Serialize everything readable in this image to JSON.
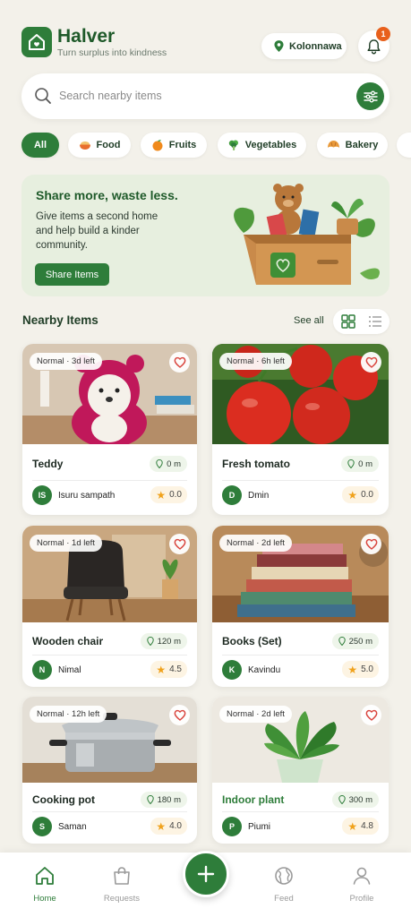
{
  "app": {
    "title": "Halver",
    "tagline": "Turn surplus into kindness",
    "location": "Kolonnawa",
    "notification_count": "1"
  },
  "search": {
    "placeholder": "Search nearby items"
  },
  "categories": [
    {
      "label": "All",
      "icon": "",
      "active": true
    },
    {
      "label": "Food",
      "icon": "food-bowl-icon"
    },
    {
      "label": "Fruits",
      "icon": "orange-icon"
    },
    {
      "label": "Vegetables",
      "icon": "broccoli-icon"
    },
    {
      "label": "Bakery",
      "icon": "croissant-icon"
    }
  ],
  "banner": {
    "title": "Share more, waste less.",
    "text": "Give items a second home and help build a kinder community.",
    "button": "Share Items"
  },
  "section": {
    "title": "Nearby Items",
    "see_all": "See all"
  },
  "items": [
    {
      "name": "Teddy",
      "time": "Normal · 3d left",
      "distance": "0 m",
      "owner_initials": "IS",
      "owner": "Isuru sampath",
      "rating": "0.0",
      "image": "teddy-bear"
    },
    {
      "name": "Fresh tomato",
      "time": "Normal · 6h left",
      "distance": "0 m",
      "owner_initials": "D",
      "owner": "Dmin",
      "rating": "0.0",
      "image": "tomatoes"
    },
    {
      "name": "Wooden chair",
      "time": "Normal · 1d left",
      "distance": "120 m",
      "owner_initials": "N",
      "owner": "Nimal",
      "rating": "4.5",
      "image": "chair"
    },
    {
      "name": "Books (Set)",
      "time": "Normal · 2d left",
      "distance": "250 m",
      "owner_initials": "K",
      "owner": "Kavindu",
      "rating": "5.0",
      "image": "books"
    },
    {
      "name": "Cooking pot",
      "time": "Normal · 12h left",
      "distance": "180 m",
      "owner_initials": "S",
      "owner": "Saman",
      "rating": "4.0",
      "image": "cooking-pot"
    },
    {
      "name": "Indoor plant",
      "time": "Normal · 2d left",
      "distance": "300 m",
      "owner_initials": "P",
      "owner": "Piumi",
      "rating": "4.8",
      "image": "plant"
    }
  ],
  "nav": {
    "home": "Home",
    "requests": "Requests",
    "feed": "Feed",
    "profile": "Profile"
  },
  "colors": {
    "primary": "#2e7d3a",
    "badge": "#e8601c",
    "star": "#f0a21c",
    "background": "#f3f1ea"
  }
}
